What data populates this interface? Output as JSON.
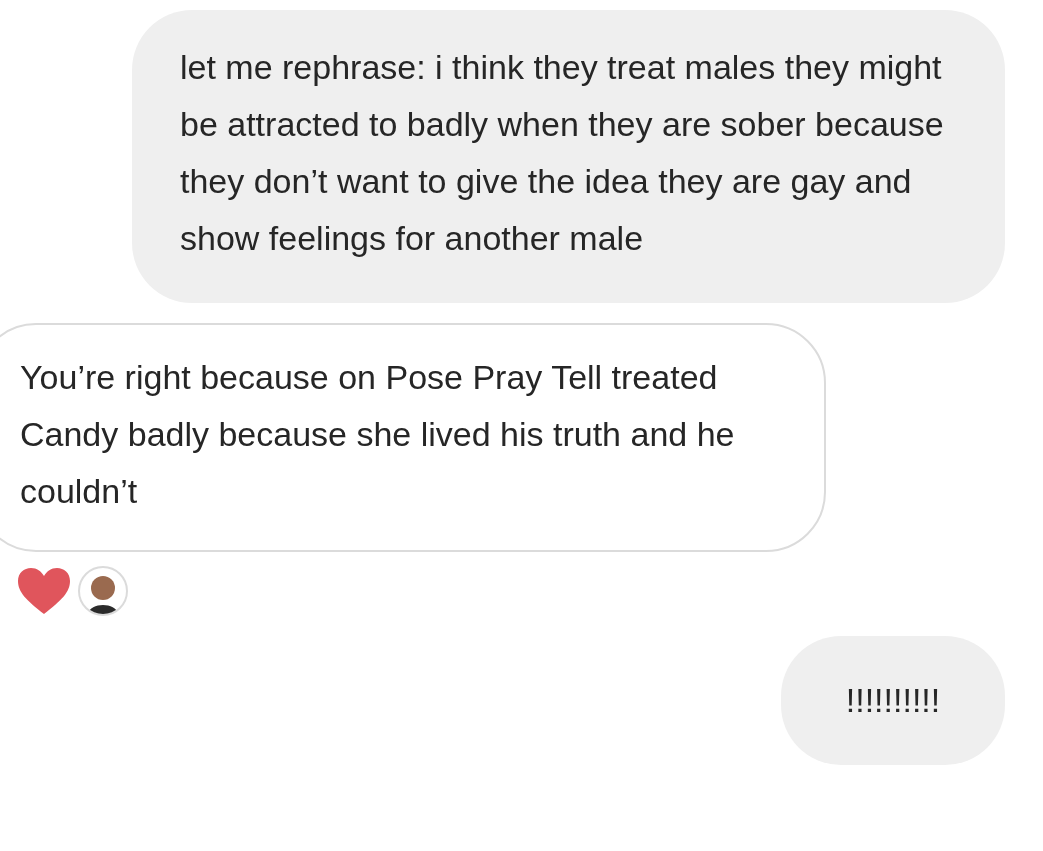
{
  "messages": [
    {
      "kind": "outgoing",
      "text": "let me rephrase: i think they treat males they might be attracted to badly when they are sober because they don’t want to give the idea they are gay and show feelings for another male"
    },
    {
      "kind": "incoming",
      "text": "You’re right because on Pose Pray Tell treated Candy badly because she lived his truth and he couldn’t",
      "reactions": [
        {
          "kind": "heart"
        },
        {
          "kind": "avatar"
        }
      ]
    },
    {
      "kind": "outgoing",
      "text": "!!!!!!!!!!"
    }
  ]
}
